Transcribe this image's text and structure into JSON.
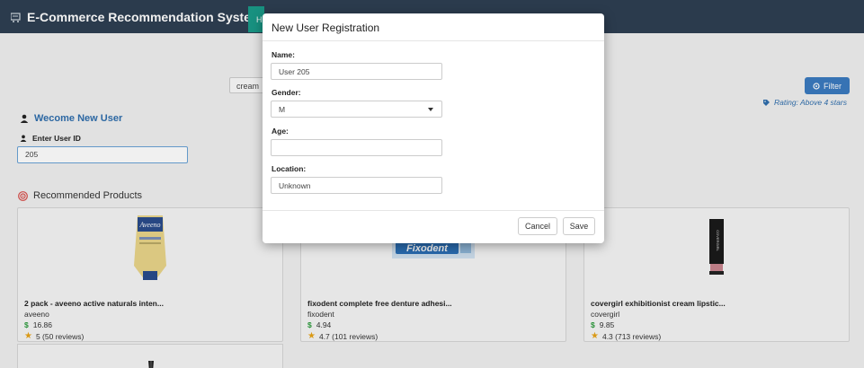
{
  "nav": {
    "brand": "E-Commerce Recommendation System",
    "active_tab": "H"
  },
  "search": {
    "value": "cream"
  },
  "filter": {
    "label": "Filter",
    "rating_note": "Rating: Above 4 stars"
  },
  "welcome": {
    "title": "Wecome New User",
    "user_id_label": "Enter User ID",
    "user_id_value": "205"
  },
  "recommended": {
    "title": "Recommended Products",
    "products": [
      {
        "name": "2 pack - aveeno active naturals inten...",
        "brand": "aveeno",
        "price": "16.86",
        "rating": "5 (50 reviews)"
      },
      {
        "name": "fixodent complete free denture adhesi...",
        "brand": "fixodent",
        "price": "4.94",
        "rating": "4.7 (101 reviews)"
      },
      {
        "name": "covergirl exhibitionist cream lipstic...",
        "brand": "covergirl",
        "price": "9.85",
        "rating": "4.3 (713 reviews)"
      }
    ]
  },
  "product_images": {
    "aveeno": "Aveeno",
    "fixodent": "Fixodent",
    "covergirl": "COVERGIRL"
  },
  "modal": {
    "title": "New User Registration",
    "name_label": "Name:",
    "name_value": "User 205",
    "gender_label": "Gender:",
    "gender_value": "M",
    "age_label": "Age:",
    "age_value": "",
    "location_label": "Location:",
    "location_value": "Unknown",
    "cancel_label": "Cancel",
    "save_label": "Save"
  },
  "colors": {
    "navbar": "#2e3f52",
    "accent": "#1a9b89",
    "primary": "#3b7bc0",
    "link": "#2f6ead",
    "price": "#2a9a3a",
    "star": "#e8a317"
  }
}
